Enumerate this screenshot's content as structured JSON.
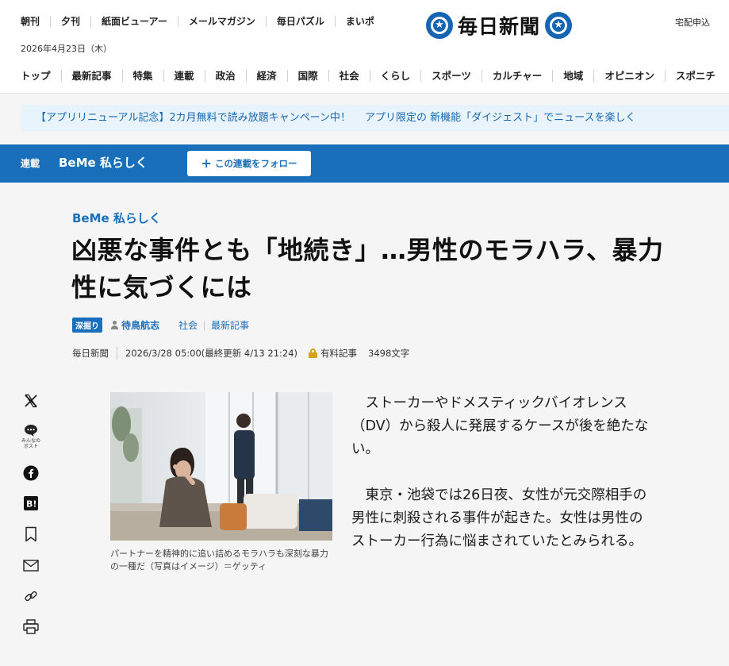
{
  "header": {
    "util_links": [
      "朝刊",
      "夕刊",
      "紙面ビューアー",
      "メールマガジン",
      "毎日パズル",
      "まいポ"
    ],
    "date": "2026年4月23日（木）",
    "logo_text": "毎日新聞",
    "delivery": "宅配申込",
    "nav": [
      "トップ",
      "最新記事",
      "特集",
      "連載",
      "政治",
      "経済",
      "国際",
      "社会",
      "くらし",
      "スポーツ",
      "カルチャー",
      "地域",
      "オピニオン",
      "スポニチ"
    ]
  },
  "promo": {
    "text1": "【アプリリニューアル記念】2カ月無料で読み放題キャンペーン中！",
    "text2": "アプリ限定の 新機能「ダイジェスト」でニュースを楽しく"
  },
  "series_bar": {
    "tag": "連載",
    "title": "BeMe 私らしく",
    "follow_label": "この連載をフォロー"
  },
  "article": {
    "series_label": "BeMe 私らしく",
    "headline_line1": "凶悪な事件とも「地続き」…男性のモラハラ、暴力",
    "headline_line2": "性に気づくには",
    "badge": "深掘り",
    "author": "待鳥航志",
    "category": "社会",
    "latest": "最新記事",
    "source": "毎日新聞",
    "datetime": "2026/3/28 05:00(最終更新 4/13 21:24)",
    "paid": "有料記事",
    "char_count": "3498文字",
    "caption": "パートナーを精神的に追い詰めるモラハラも深刻な暴力の一種だ（写真はイメージ）＝ゲッティ",
    "paragraphs": [
      "ストーカーやドメスティックバイオレンス（DV）から殺人に発展するケースが後を絶たない。",
      "東京・池袋では26日夜、女性が元交際相手の男性に刺殺される事件が起きた。女性は男性のストーカー行為に悩まされていたとみられる。"
    ]
  },
  "share": {
    "minna_post_label": "みんなの\nポスト"
  },
  "colors": {
    "brand_blue": "#1a6fba",
    "promo_bg": "#e9f3fb",
    "lock_gold": "#d4a21f"
  }
}
